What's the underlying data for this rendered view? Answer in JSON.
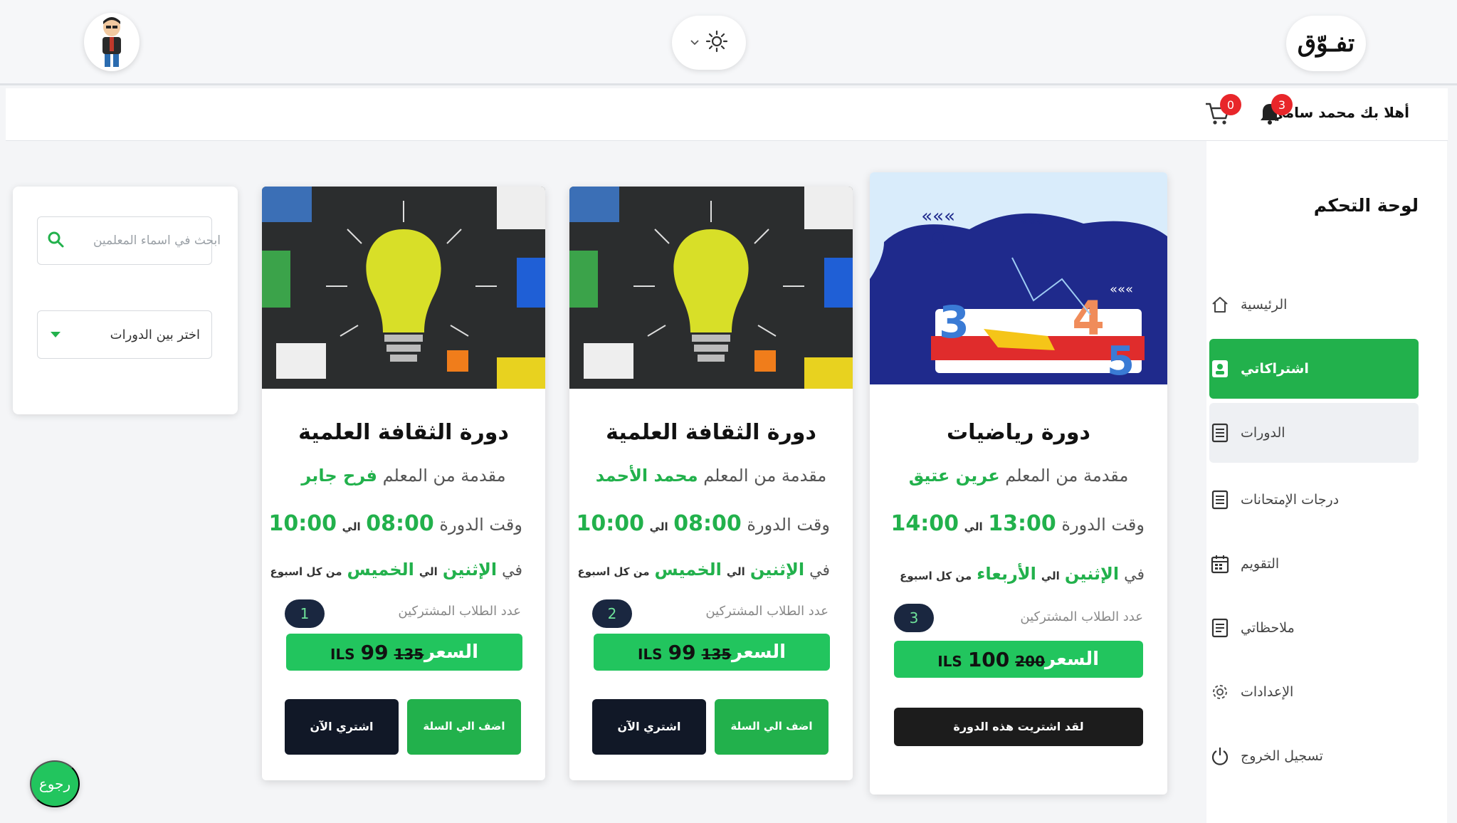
{
  "header": {
    "logo_text": "تفـوّق",
    "theme_icon": "sun-icon",
    "avatar_icon": "user-avatar"
  },
  "subbar": {
    "greeting": "أهلا بك محمد سامي",
    "notifications_count": "3",
    "cart_count": "0"
  },
  "sidebar": {
    "title": "لوحة التحكم",
    "items": [
      {
        "label": "الرئيسية",
        "icon": "home-icon"
      },
      {
        "label": "اشتراكاتي",
        "icon": "subscriptions-icon",
        "active": true
      },
      {
        "label": "الدورات",
        "icon": "courses-icon"
      },
      {
        "label": "درجات الإمتحانات",
        "icon": "grades-icon"
      },
      {
        "label": "التقويم",
        "icon": "calendar-icon"
      },
      {
        "label": "ملاحظاتي",
        "icon": "notes-icon"
      },
      {
        "label": "الإعدادات",
        "icon": "settings-icon"
      },
      {
        "label": "تسجيل الخروج",
        "icon": "logout-icon"
      }
    ]
  },
  "filters": {
    "search_placeholder": "ابحث في اسماء المعلمين",
    "select_label": "اختر بين الدورات"
  },
  "courses": [
    {
      "title": "دورة رياضيات",
      "teacher_prefix": "مقدمة من المعلم",
      "teacher_name": "عرين عتيق",
      "time_prefix": "وقت الدورة",
      "time_from": "13:00",
      "time_to_word": "الي",
      "time_to": "14:00",
      "days_prefix": "في",
      "day_from": "الإثنين",
      "day_to_word": "الي",
      "day_to": "الأربعاء",
      "days_suffix": "من كل اسبوع",
      "students_label": "عدد الطلاب المشتركين",
      "students_count": "3",
      "price_label": "السعر",
      "currency": "ILS",
      "price_now": "100",
      "price_old": "200",
      "purchased_label": "لقد اشتريت هذه الدورة"
    },
    {
      "title": "دورة الثقافة العلمية",
      "teacher_prefix": "مقدمة من المعلم",
      "teacher_name": "محمد الأحمد",
      "time_prefix": "وقت الدورة",
      "time_from": "08:00",
      "time_to_word": "الي",
      "time_to": "10:00",
      "days_prefix": "في",
      "day_from": "الإثنين",
      "day_to_word": "الي",
      "day_to": "الخميس",
      "days_suffix": "من كل اسبوع",
      "students_label": "عدد الطلاب المشتركين",
      "students_count": "2",
      "price_label": "السعر",
      "currency": "ILS",
      "price_now": "99",
      "price_old": "135",
      "add_to_cart_label": "اضف الي السلة",
      "buy_now_label": "اشتري الآن"
    },
    {
      "title": "دورة الثقافة العلمية",
      "teacher_prefix": "مقدمة من المعلم",
      "teacher_name": "فرح جابر",
      "time_prefix": "وقت الدورة",
      "time_from": "08:00",
      "time_to_word": "الي",
      "time_to": "10:00",
      "days_prefix": "في",
      "day_from": "الإثنين",
      "day_to_word": "الي",
      "day_to": "الخميس",
      "days_suffix": "من كل اسبوع",
      "students_label": "عدد الطلاب المشتركين",
      "students_count": "1",
      "price_label": "السعر",
      "currency": "ILS",
      "price_now": "99",
      "price_old": "135",
      "add_to_cart_label": "اضف الي السلة",
      "buy_now_label": "اشتري الآن"
    }
  ],
  "back_button": "رجوع",
  "colors": {
    "primary_green": "#22b14c",
    "dark_navy": "#111827",
    "badge_red": "#e8262a"
  }
}
